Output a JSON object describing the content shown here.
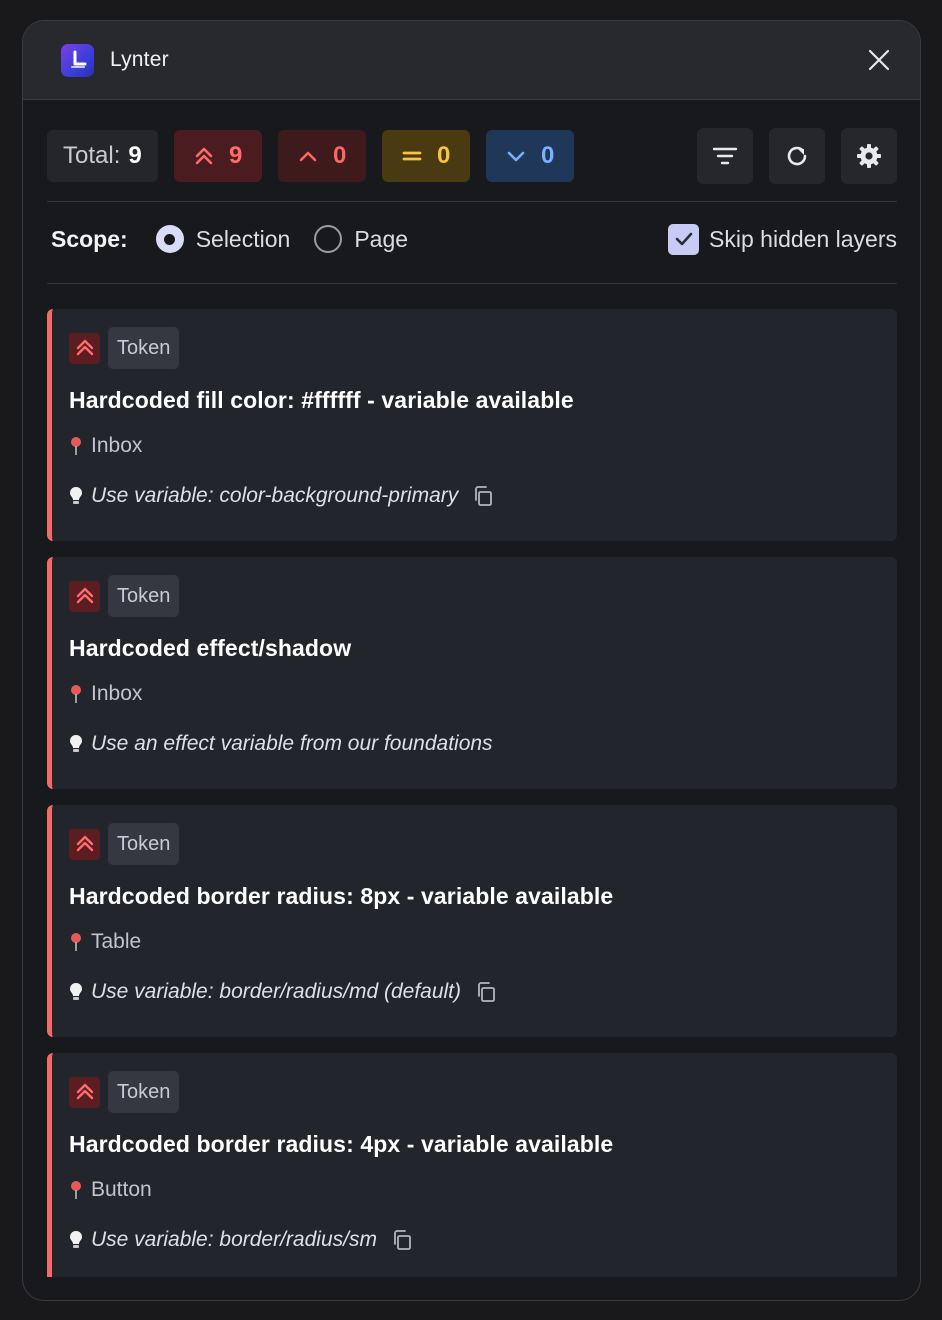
{
  "app": {
    "title": "Lynter",
    "icon": "lynter-logo-icon",
    "accent": "#5a3fe0"
  },
  "summary": {
    "total_label": "Total:",
    "total_count": "9",
    "counts": [
      {
        "key": "critical",
        "icon": "double-chevron-up-icon",
        "value": "9",
        "color": "#ff6b6b"
      },
      {
        "key": "high",
        "icon": "chevron-up-icon",
        "value": "0",
        "color": "#ff6464"
      },
      {
        "key": "medium",
        "icon": "equals-icon",
        "value": "0",
        "color": "#f6c343"
      },
      {
        "key": "low",
        "icon": "chevron-down-icon",
        "value": "0",
        "color": "#79b1ff"
      }
    ]
  },
  "scope": {
    "label": "Scope:",
    "options": [
      {
        "label": "Selection",
        "selected": true
      },
      {
        "label": "Page",
        "selected": false
      }
    ],
    "skip_hidden": {
      "label": "Skip hidden layers",
      "checked": true
    }
  },
  "issues": [
    {
      "category": "Token",
      "title": "Hardcoded fill color: #ffffff - variable available",
      "location": "Inbox",
      "suggestion": "Use variable: color-background-primary",
      "copyable": true
    },
    {
      "category": "Token",
      "title": "Hardcoded effect/shadow",
      "location": "Inbox",
      "suggestion": "Use an effect variable from our foundations",
      "copyable": false
    },
    {
      "category": "Token",
      "title": "Hardcoded border radius: 8px - variable available",
      "location": "Table",
      "suggestion": "Use variable: border/radius/md (default)",
      "copyable": true
    },
    {
      "category": "Token",
      "title": "Hardcoded border radius: 4px - variable available",
      "location": "Button",
      "suggestion": "Use variable: border/radius/sm",
      "copyable": true
    }
  ]
}
